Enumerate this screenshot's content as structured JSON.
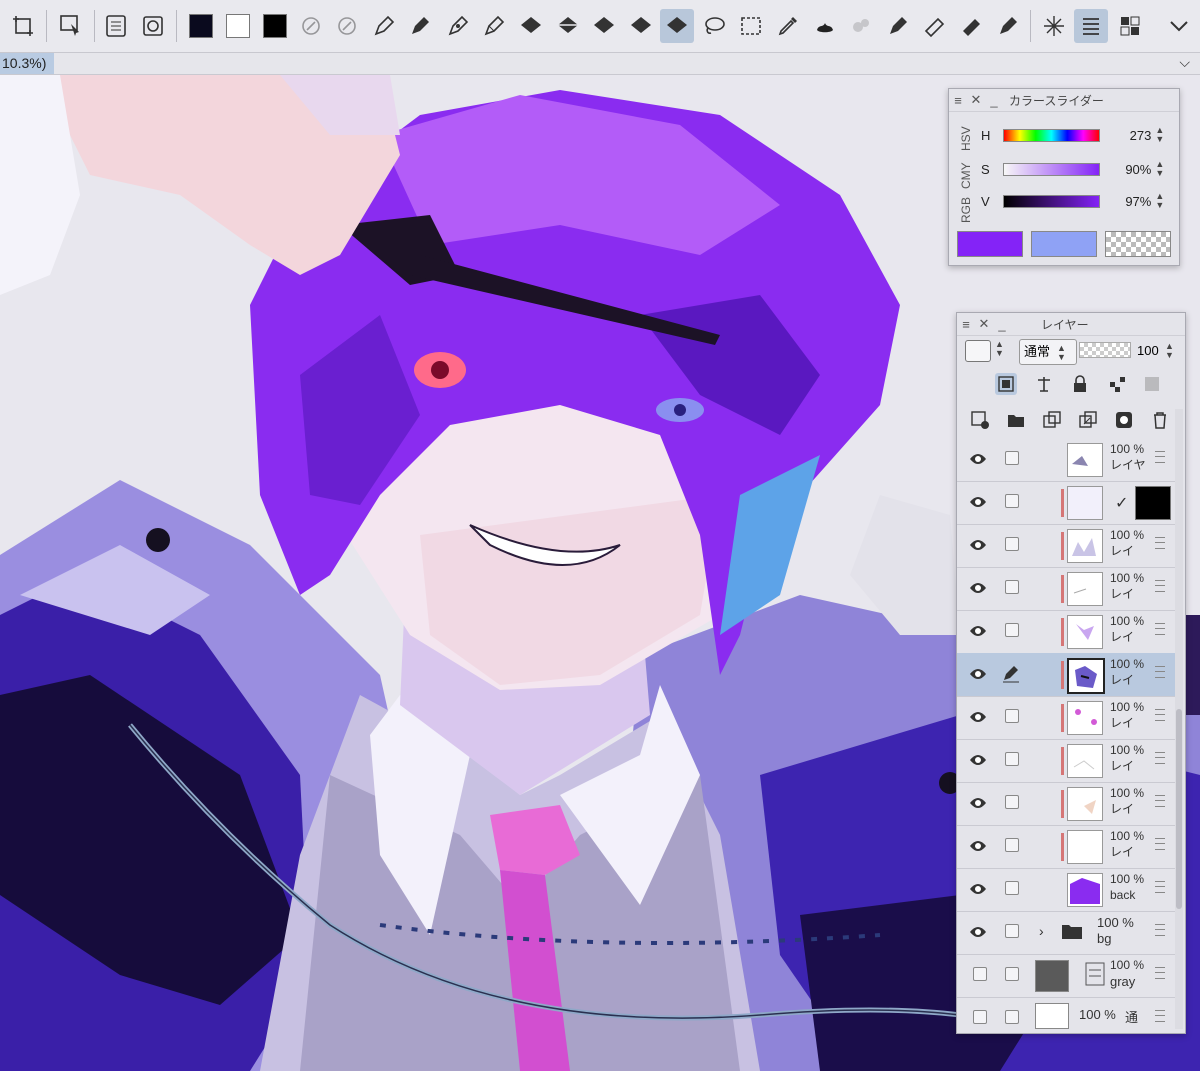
{
  "toolbar": {
    "colors": {
      "main": "#0a0a1e",
      "sub": "#ffffff",
      "transparent_marker": "#000000"
    },
    "tools": [
      "transform-icon",
      "select-layer-icon",
      "tone-icon",
      "fill-icon",
      "pen-icon",
      "pen2-icon",
      "pen3-icon",
      "pen4-icon",
      "bucket-icon",
      "bucket2-icon",
      "bucket3-icon",
      "bucket4-icon",
      "bucket5-icon",
      "lasso-icon",
      "rect-select-icon",
      "dropper-icon",
      "blot-icon",
      "airbrush-icon",
      "marker-icon",
      "eraser-icon",
      "eraser2-icon",
      "eraser3-icon",
      "sparkle-icon",
      "layer-list-icon",
      "grid-icon"
    ]
  },
  "status": {
    "zoom": "10.3%)"
  },
  "color_slider": {
    "title": "カラースライダー",
    "tabs": [
      "HSV",
      "CMY",
      "RGB"
    ],
    "rows": [
      {
        "label": "H",
        "value": "273"
      },
      {
        "label": "S",
        "value": "90%"
      },
      {
        "label": "V",
        "value": "97%"
      }
    ],
    "current_color": "#8423f7",
    "sub_color": "#8fa2f5"
  },
  "layer_panel": {
    "title": "レイヤー",
    "blend_mode": "通常",
    "opacity": "100",
    "layers": [
      {
        "opacity": "100 %",
        "name": "レイヤ",
        "clipped": false
      },
      {
        "opacity": "",
        "name": "",
        "clipped": true
      },
      {
        "opacity": "100 %",
        "name": "レイ",
        "clipped": true
      },
      {
        "opacity": "100 %",
        "name": "レイ",
        "clipped": true
      },
      {
        "opacity": "100 %",
        "name": "レイ",
        "clipped": true
      },
      {
        "opacity": "100 %",
        "name": "レイ",
        "clipped": true
      },
      {
        "opacity": "100 %",
        "name": "レイ",
        "clipped": true
      },
      {
        "opacity": "100 %",
        "name": "レイ",
        "clipped": true
      },
      {
        "opacity": "100 %",
        "name": "レイ",
        "clipped": true
      },
      {
        "opacity": "100 %",
        "name": "レイ",
        "clipped": true
      },
      {
        "opacity": "100 %",
        "name": "back",
        "clipped": false
      },
      {
        "opacity": "100 %",
        "name": "bg",
        "clipped": false
      },
      {
        "opacity": "100 %",
        "name": "gray",
        "clipped": false
      },
      {
        "opacity": "100 %",
        "name": "通",
        "clipped": false
      }
    ]
  }
}
